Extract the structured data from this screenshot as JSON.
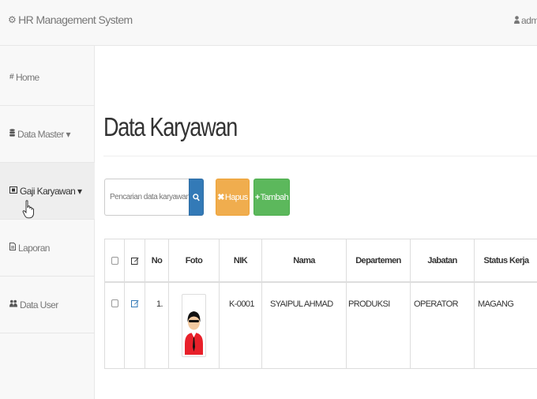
{
  "navbar": {
    "brand": "HR Management System",
    "user": "admin"
  },
  "sidebar": {
    "items": [
      {
        "label": "Home",
        "icon": "home-icon"
      },
      {
        "label": "Data Master ▾",
        "icon": "database-icon"
      },
      {
        "label": "Gaji Karyawan ▾",
        "icon": "money-icon"
      },
      {
        "label": "Laporan",
        "icon": "file-icon"
      },
      {
        "label": "Data User",
        "icon": "users-icon"
      }
    ],
    "active_index": 2
  },
  "main": {
    "title": "Data Karyawan",
    "search": {
      "placeholder": "Pencarian data karyawan..."
    },
    "buttons": {
      "hapus": "Hapus",
      "tambah": "Tambah"
    },
    "colors": {
      "primary": "#337ab7",
      "warning": "#f0ad4e",
      "success": "#5cb85c"
    }
  },
  "table": {
    "columns": [
      "",
      "",
      "No",
      "Foto",
      "NIK",
      "Nama",
      "Departemen",
      "Jabatan",
      "Status Kerja"
    ],
    "rows": [
      {
        "no": "1.",
        "nik": "K-0001",
        "nama": "SYAIPUL AHMAD",
        "departemen": "PRODUKSI",
        "jabatan": "OPERATOR",
        "status": "MAGANG"
      }
    ]
  }
}
